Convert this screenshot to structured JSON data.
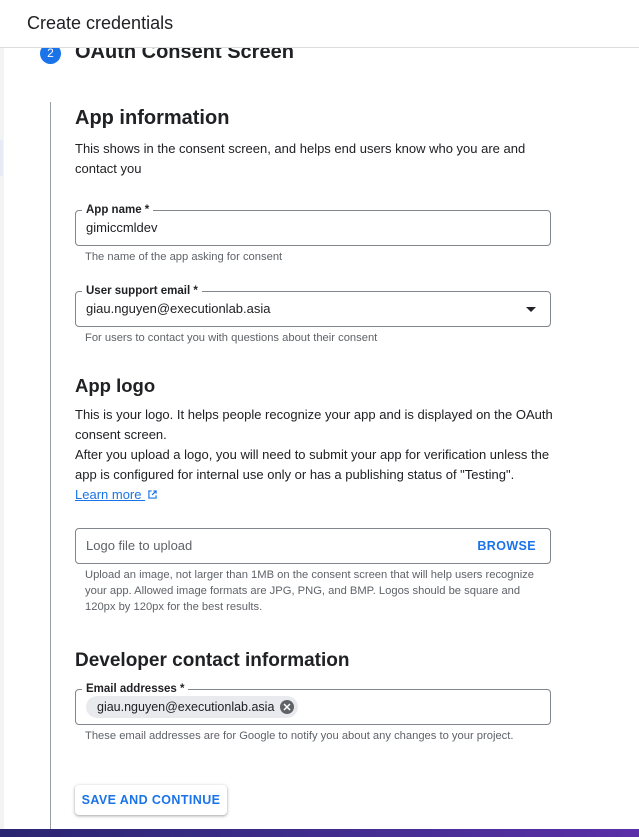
{
  "header": {
    "title": "Create credentials"
  },
  "step": {
    "number": "2",
    "title": "OAuth Consent Screen"
  },
  "app_information": {
    "heading": "App information",
    "description": "This shows in the consent screen, and helps end users know who you are and contact you",
    "app_name": {
      "label": "App name *",
      "value": "gimiccmldev",
      "hint": "The name of the app asking for consent"
    },
    "support_email": {
      "label": "User support email *",
      "value": "giau.nguyen@executionlab.asia",
      "hint": "For users to contact you with questions about their consent"
    }
  },
  "app_logo": {
    "heading": "App logo",
    "description_1": "This is your logo. It helps people recognize your app and is displayed on the OAuth consent screen.",
    "description_2": "After you upload a logo, you will need to submit your app for verification unless the app is configured for internal use only or has a publishing status of \"Testing\".",
    "learn_more": "Learn more",
    "upload_placeholder": "Logo file to upload",
    "browse_label": "BROWSE",
    "hint": "Upload an image, not larger than 1MB on the consent screen that will help users recognize your app. Allowed image formats are JPG, PNG, and BMP. Logos should be square and 120px by 120px for the best results."
  },
  "developer_contact": {
    "heading": "Developer contact information",
    "email_label": "Email addresses *",
    "email_chip": "giau.nguyen@executionlab.asia",
    "hint": "These email addresses are for Google to notify you about any changes to your project."
  },
  "actions": {
    "save_label": "SAVE AND CONTINUE"
  },
  "colors": {
    "accent": "#1a73e8",
    "text": "#202124",
    "hint": "#5f6368",
    "border": "#80868b"
  }
}
